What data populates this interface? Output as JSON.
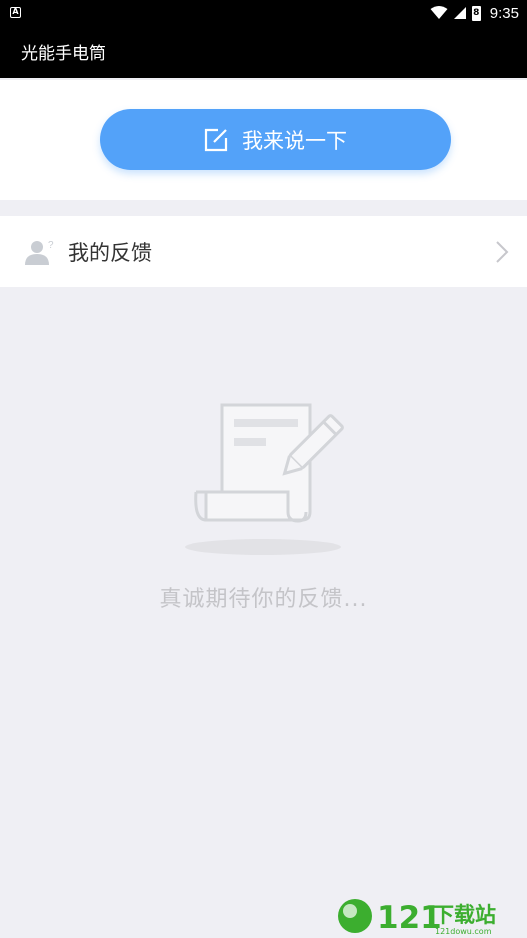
{
  "status_bar": {
    "time": "9:35",
    "notification_glyph": "A",
    "battery_level": "8"
  },
  "app_bar": {
    "title": "光能手电筒"
  },
  "post": {
    "button_label": "我来说一下"
  },
  "feedback": {
    "label": "我的反馈"
  },
  "empty": {
    "message": "真诚期待你的反馈..."
  },
  "watermark": {
    "number": "121",
    "text": "下载站",
    "site": "121dowu.com"
  },
  "colors": {
    "accent": "#53a2f9",
    "background": "#efeff4",
    "placeholder_text": "#c4c4c8",
    "icon_gray": "#c9cdd3",
    "watermark_green": "#3cae2f"
  }
}
